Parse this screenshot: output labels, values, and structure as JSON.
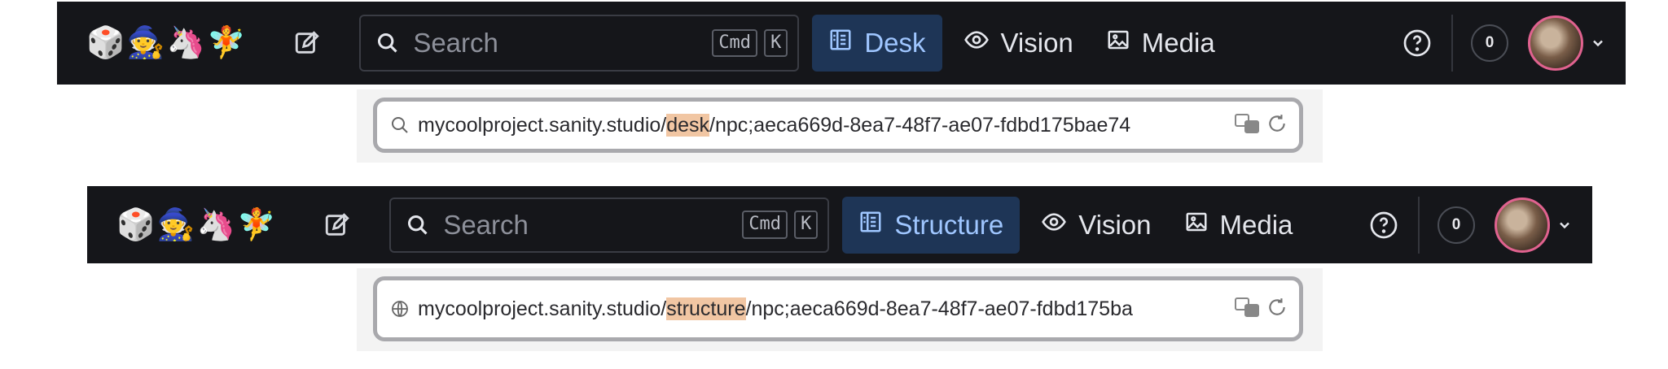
{
  "navbars": [
    {
      "emojis": [
        "🎲",
        "🧙",
        "🦄",
        "🧚"
      ],
      "search": {
        "placeholder": "Search",
        "shortcut": [
          "Cmd",
          "K"
        ]
      },
      "tools": [
        {
          "label": "Desk",
          "icon": "layout-icon",
          "active": true
        },
        {
          "label": "Vision",
          "icon": "eye-icon",
          "active": false
        },
        {
          "label": "Media",
          "icon": "image-icon",
          "active": false
        }
      ],
      "notifications": "0"
    },
    {
      "emojis": [
        "🎲",
        "🧙",
        "🦄",
        "🧚"
      ],
      "search": {
        "placeholder": "Search",
        "shortcut": [
          "Cmd",
          "K"
        ]
      },
      "tools": [
        {
          "label": "Structure",
          "icon": "layout-icon",
          "active": true
        },
        {
          "label": "Vision",
          "icon": "eye-icon",
          "active": false
        },
        {
          "label": "Media",
          "icon": "image-icon",
          "active": false
        }
      ],
      "notifications": "0"
    }
  ],
  "urlbars": [
    {
      "icon": "search-icon",
      "prefix": "mycoolproject.sanity.studio/",
      "highlight": "desk",
      "suffix": "/npc;aeca669d-8ea7-48f7-ae07-fdbd175bae74"
    },
    {
      "icon": "globe-icon",
      "prefix": "mycoolproject.sanity.studio/",
      "highlight": "structure",
      "suffix": "/npc;aeca669d-8ea7-48f7-ae07-fdbd175ba"
    }
  ],
  "colors": {
    "navbar_bg": "#15161a",
    "active_tool_bg": "#1e3556",
    "active_tool_text": "#9fc6ff",
    "url_highlight": "#f1c6a3",
    "avatar_ring": "#e0628f"
  }
}
